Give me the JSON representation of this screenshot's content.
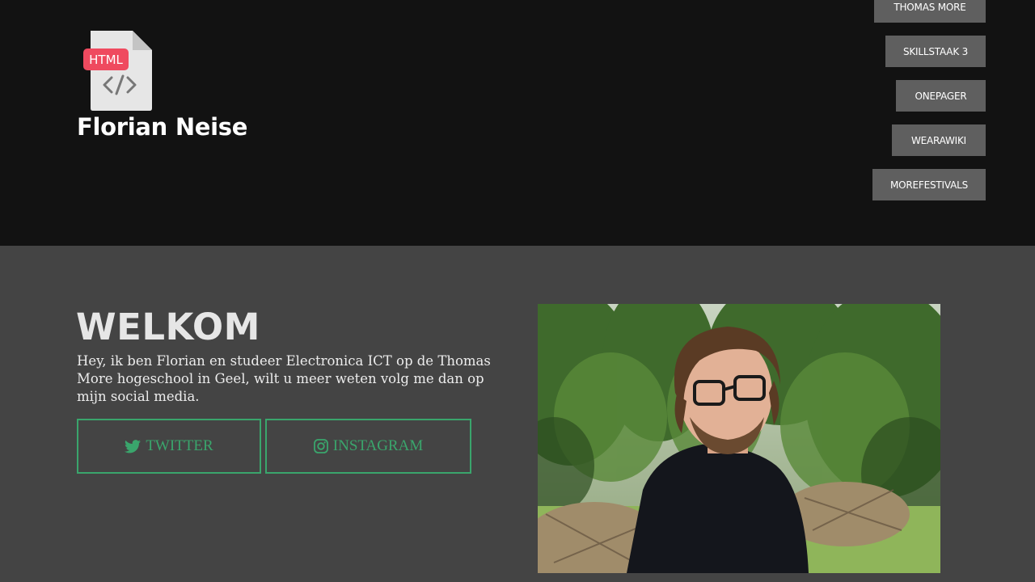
{
  "header": {
    "logo_badge": "HTML",
    "site_title": "Florian Neise",
    "nav": [
      {
        "label": "THOMAS MORE"
      },
      {
        "label": "SKILLSTAAK 3"
      },
      {
        "label": "ONEPAGER"
      },
      {
        "label": "WEARAWIKI"
      },
      {
        "label": "MOREFESTIVALS"
      }
    ]
  },
  "main": {
    "title": "WELKOM",
    "intro": "Hey, ik ben Florian en studeer Electronica ICT op de Thomas More hogeschool in Geel, wilt u meer weten volg me dan op mijn social media.",
    "social": {
      "twitter": {
        "label": "TWITTER",
        "icon": "twitter-icon"
      },
      "instagram": {
        "label": "INSTAGRAM",
        "icon": "instagram-icon"
      }
    },
    "photo": {
      "icon": "profile-photo"
    }
  },
  "colors": {
    "header_bg": "#121212",
    "page_bg": "#444444",
    "nav_bg": "#5f5f5f",
    "accent": "#3aa56c",
    "badge": "#ef4a5f"
  }
}
